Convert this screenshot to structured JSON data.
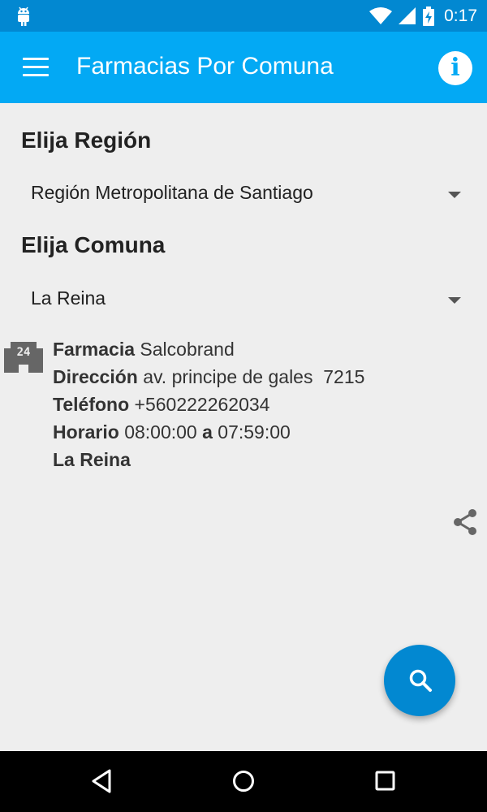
{
  "status_bar": {
    "time": "0:17",
    "icons": [
      "android-icon",
      "wifi-icon",
      "signal-icon",
      "battery-charging-icon"
    ]
  },
  "app_bar": {
    "title": "Farmacias Por Comuna",
    "menu_icon": "menu-icon",
    "info_icon": "info-icon",
    "info_glyph": "i",
    "background": "#03a9f4"
  },
  "region": {
    "heading": "Elija Región",
    "selected": "Región Metropolitana de Santiago"
  },
  "comuna": {
    "heading": "Elija Comuna",
    "selected": "La Reina"
  },
  "pharmacy": {
    "icon": "pharmacy-24h-icon",
    "name_label": "Farmacia",
    "name": "Salcobrand",
    "address_label": "Dirección",
    "address": "av. principe de gales  7215",
    "phone_label": "Teléfono",
    "phone": "+560222262034",
    "hours_label": "Horario",
    "open": "08:00:00",
    "hours_separator": "a",
    "close": "07:59:00",
    "comuna": "La Reina"
  },
  "actions": {
    "share_icon": "share-icon",
    "search_icon": "search-icon",
    "fab_color": "#0288d1"
  },
  "nav_bar": {
    "back_icon": "back-icon",
    "home_icon": "home-icon",
    "recents_icon": "recents-icon"
  }
}
